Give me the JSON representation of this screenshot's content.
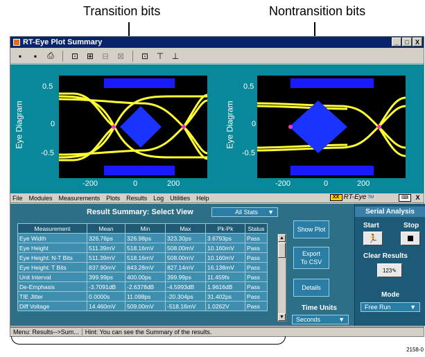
{
  "callouts": {
    "transition": "Transition bits",
    "nontransition": "Nontransition bits"
  },
  "window": {
    "title": "RT-Eye Plot Summary",
    "buttons": [
      "_",
      "□",
      "X"
    ]
  },
  "plots": {
    "ylabel": "Eye Diagram",
    "y_ticks": [
      "0.5",
      "0",
      "-0.5"
    ],
    "x_ticks": [
      "-200",
      "0",
      "200"
    ]
  },
  "menu": {
    "items": [
      "File",
      "Modules",
      "Measurements",
      "Plots",
      "Results",
      "Log",
      "Utilities",
      "Help"
    ],
    "logo": "RT-Eye",
    "logo_mark": "TM",
    "close": "X"
  },
  "summary": {
    "title": "Result Summary: Select View",
    "view": "All Stats",
    "columns": [
      "Measurement",
      "Mean",
      "Min",
      "Max",
      "Pk-Pk",
      "Status"
    ],
    "rows": [
      [
        "Eye Width",
        "326.76ps",
        "326.98ps",
        "323.30ps",
        "3.6793ps",
        "Pass"
      ],
      [
        "Eye Height",
        "511.39mV",
        "518.16mV",
        "508.00mV",
        "10.160mV",
        "Pass"
      ],
      [
        "Eye Height: N-T Bits",
        "511.39mV",
        "518.16mV",
        "508.00mV",
        "10.160mV",
        "Pass"
      ],
      [
        "Eye Height: T Bits",
        "837.90mV",
        "843.28mV",
        "827.14mV",
        "16.138mV",
        "Pass"
      ],
      [
        "Unit Interval",
        "399.99ps",
        "400.00ps",
        "399.99ps",
        "11.459fs",
        "Pass"
      ],
      [
        "De-Emphasis",
        "-3.7091dB",
        "-2.6378dB",
        "-4.5993dB",
        "1.9616dB",
        "Pass"
      ],
      [
        "TIE Jitter",
        "0.0000s",
        "11.098ps",
        "-20.304ps",
        "31.402ps",
        "Pass"
      ],
      [
        "Diff Voltage",
        "14.460mV",
        "509.00mV",
        "-518.16mV",
        "1.0262V",
        "Pass"
      ]
    ],
    "show_plot": "Show Plot",
    "export_line1": "Export",
    "export_line2": "To CSV",
    "details": "Details",
    "time_units_label": "Time Units",
    "time_units": "Seconds"
  },
  "serial": {
    "title": "Serial Analysis",
    "start": "Start",
    "stop": "Stop",
    "clear": "Clear Results",
    "mode_label": "Mode",
    "mode": "Free Run"
  },
  "status": {
    "menu_path": "Menu: Results-->Sum...",
    "hint": "Hint: You can see the Summary of the results."
  },
  "figure_id": "2158-0"
}
